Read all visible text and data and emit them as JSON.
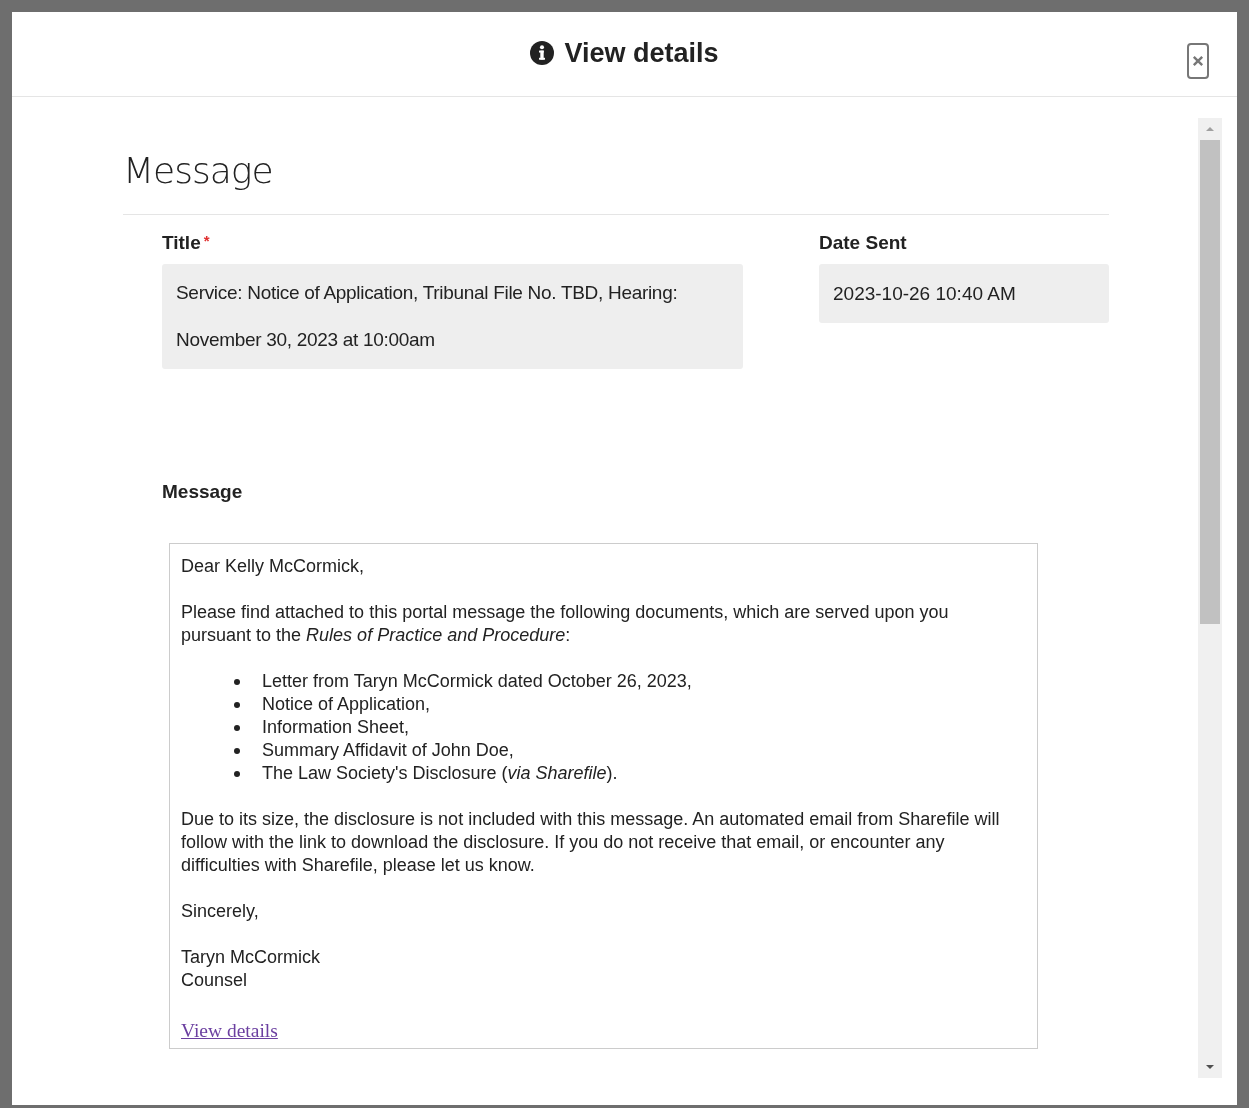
{
  "dialog": {
    "title": "View details"
  },
  "section": {
    "heading": "Message"
  },
  "fields": [
    {
      "kind": "title",
      "label": "Title",
      "required_mark": "*",
      "value": "Service: Notice of Application, Tribunal File No. TBD, Hearing: November 30, 2023 at 10:00am"
    },
    {
      "kind": "date",
      "label": "Date Sent",
      "value": "2023-10-26 10:40 AM"
    }
  ],
  "message": {
    "label": "Message",
    "greeting": "Dear Kelly McCormick,",
    "intro": "Please find attached to this portal message the following documents, which are served upon you pursuant to the *Rules of Practice and Procedure*:",
    "documents": [
      "Letter from Taryn McCormick dated October 26, 2023,",
      "Notice of Application,",
      "Information Sheet,",
      "Summary Affidavit of John Doe,",
      "The Law Society's Disclosure (*via Sharefile*)."
    ],
    "note": "Due to its size, the disclosure is not included with this message. An automated email from Sharefile will follow with the link to download the disclosure. If you do not receive that email, or encounter any difficulties with Sharefile, please let us know.",
    "closing": "Sincerely,",
    "signature": [
      "Taryn McCormick",
      "Counsel"
    ],
    "link": "View details"
  }
}
